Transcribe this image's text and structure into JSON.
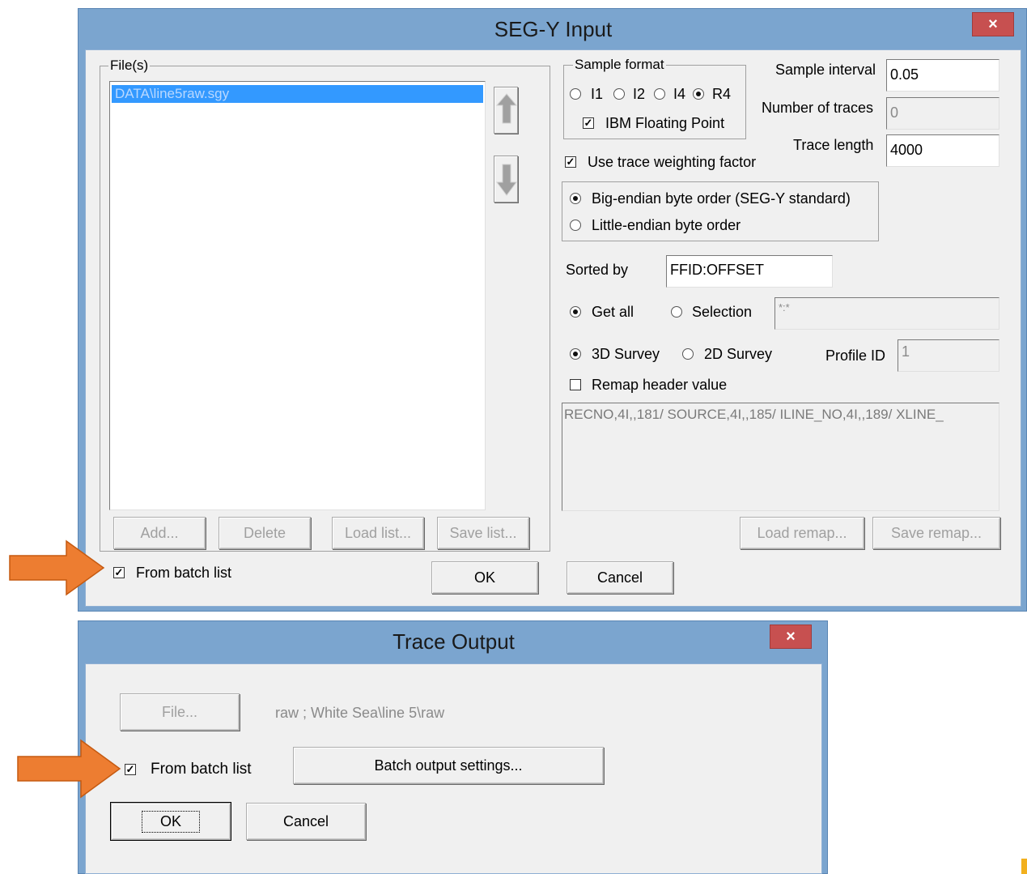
{
  "segy_dialog": {
    "title": "SEG-Y Input",
    "close_glyph": "×",
    "files_group_label": "File(s)",
    "files": [
      "DATA\\line5raw.sgy"
    ],
    "move_up_icon": "arrow-up-icon",
    "move_down_icon": "arrow-down-icon",
    "buttons": {
      "add": "Add...",
      "delete": "Delete",
      "load_list": "Load list...",
      "save_list": "Save list...",
      "ok": "OK",
      "cancel": "Cancel",
      "load_remap": "Load remap...",
      "save_remap": "Save remap..."
    },
    "from_batch_list": {
      "label": "From batch list",
      "checked": true
    },
    "sample_format": {
      "group_label": "Sample format",
      "options": [
        "I1",
        "I2",
        "I4",
        "R4"
      ],
      "selected": "R4",
      "ibm_floating_point": {
        "label": "IBM Floating Point",
        "checked": true
      }
    },
    "sample_interval": {
      "label": "Sample interval",
      "value": "0.05"
    },
    "number_of_traces": {
      "label": "Number of traces",
      "value": "0"
    },
    "trace_length": {
      "label": "Trace length",
      "value": "4000"
    },
    "use_trace_weighting": {
      "label": "Use trace weighting factor",
      "checked": true
    },
    "byte_order": {
      "big_endian": "Big-endian byte order (SEG-Y standard)",
      "little_endian": "Little-endian byte order",
      "selected": "big"
    },
    "sorted_by": {
      "label": "Sorted by",
      "value": "FFID:OFFSET"
    },
    "get_all": "Get all",
    "selection": "Selection",
    "selection_value": "*:*",
    "survey_3d": "3D Survey",
    "survey_2d": "2D Survey",
    "profile_id": {
      "label": "Profile ID",
      "value": "1"
    },
    "remap_header": {
      "label": "Remap header value",
      "checked": false
    },
    "remap_text": "RECNO,4I,,181/ SOURCE,4I,,185/ ILINE_NO,4I,,189/ XLINE_"
  },
  "trace_dialog": {
    "title": "Trace Output",
    "close_glyph": "×",
    "file_button": "File...",
    "file_path": "raw ; White Sea\\line 5\\raw",
    "from_batch_list": {
      "label": "From batch list",
      "checked": true
    },
    "batch_output_settings": "Batch output settings...",
    "ok": "OK",
    "cancel": "Cancel"
  },
  "colors": {
    "window_frame": "#7ba5cf",
    "close_button": "#c75050",
    "highlight_arrow": "#ed7d31",
    "selection": "#3399ff"
  },
  "check_glyph": "✓"
}
